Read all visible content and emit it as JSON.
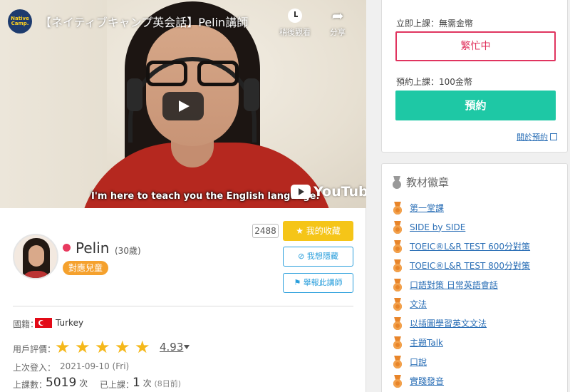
{
  "video": {
    "title": "【ネイティブキャンプ英会話】Pelin講師",
    "channel_logo_line1": "Native",
    "channel_logo_line2": "Camp.",
    "watch_later_label": "稍後觀看",
    "share_label": "分享",
    "caption": "I'm here to teach you the English language.",
    "brand": "YouTube"
  },
  "teacher": {
    "name": "Pelin",
    "age": "(30歲)",
    "kids_badge": "對應兒童",
    "favorite_count": "2488",
    "favorite_label": "我的收藏",
    "hide_label": "我想隱藏",
    "report_label": "舉報此講師",
    "nationality_label": "國籍：",
    "nationality": "Turkey",
    "rating_label": "用戶評價：",
    "rating": "4.93",
    "stars_filled": 5,
    "last_login_label": "上次登入：",
    "last_login": "2021-09-10 (Fri)",
    "lessons_label": "上課數：",
    "lessons_count": "5019",
    "lessons_unit": "次",
    "taken_label": "已上課：",
    "taken_count": "1",
    "taken_unit": "次",
    "taken_ago": "(8日前)"
  },
  "booking": {
    "instant_label": "立即上課：無需金幣",
    "busy_label": "繁忙中",
    "reserve_label": "預約上課：100金幣",
    "reserve_button": "預約",
    "about_link": "關於預約"
  },
  "badges": {
    "title": "教材徽章",
    "items": [
      "第一堂課",
      "SIDE by SIDE",
      "TOEIC®L&R TEST 600分對策",
      "TOEIC®L&R TEST 800分對策",
      "口語對策 日常英語會話",
      "文法",
      "以插圖學習英文文法",
      "主題Talk",
      "口說",
      "實踐發音"
    ]
  },
  "colors": {
    "accent_green": "#1ec8a5",
    "busy_red": "#e0345f",
    "favorite_yellow": "#f5c518",
    "link_blue": "#2b6fb6",
    "kids_orange": "#f5a12d"
  }
}
